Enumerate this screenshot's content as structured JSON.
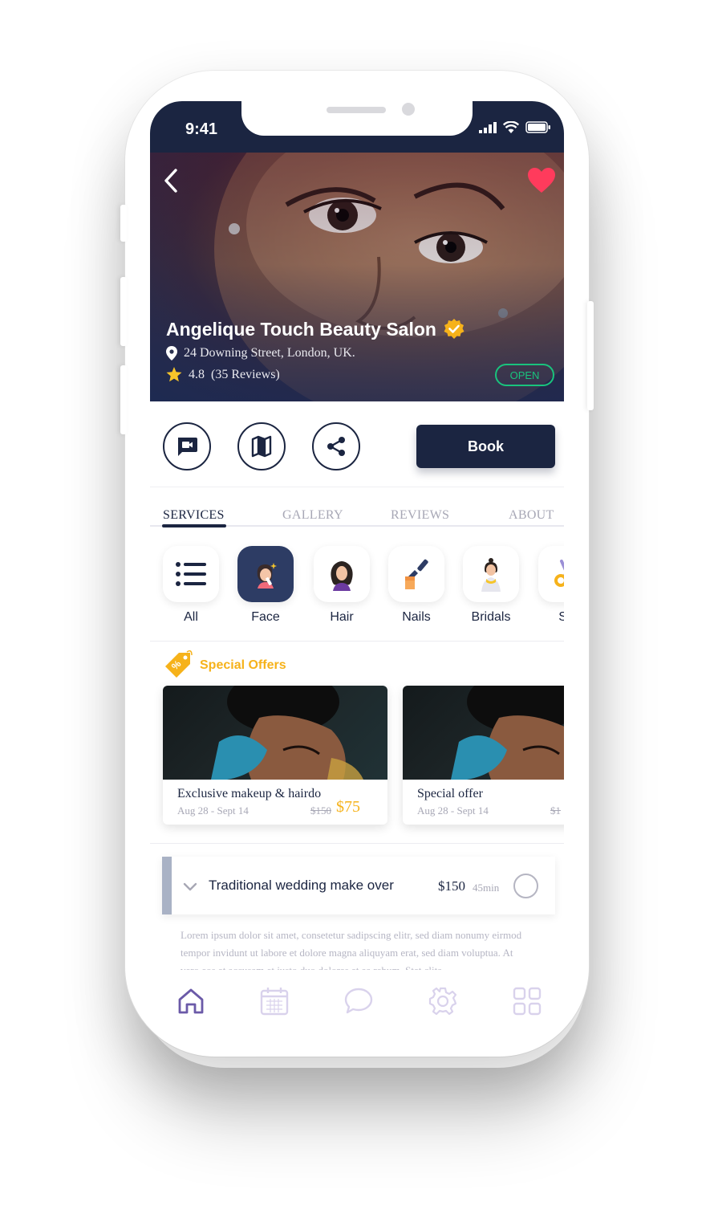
{
  "status_bar": {
    "time": "9:41"
  },
  "salon": {
    "name": "Angelique Touch Beauty Salon",
    "address": "24 Downing Street, London, UK.",
    "rating": "4.8",
    "reviews": "(35 Reviews)",
    "status": "OPEN"
  },
  "actions": {
    "book_label": "Book"
  },
  "tabs": [
    {
      "label": "SERVICES",
      "active": true
    },
    {
      "label": "GALLERY",
      "active": false
    },
    {
      "label": "REVIEWS",
      "active": false
    },
    {
      "label": "ABOUT",
      "active": false
    }
  ],
  "categories": [
    {
      "label": "All",
      "icon": "list-icon",
      "active": false
    },
    {
      "label": "Face",
      "icon": "face-makeup-icon",
      "active": true
    },
    {
      "label": "Hair",
      "icon": "hair-icon",
      "active": false
    },
    {
      "label": "Nails",
      "icon": "nail-polish-icon",
      "active": false
    },
    {
      "label": "Bridals",
      "icon": "bride-icon",
      "active": false
    },
    {
      "label": "Sa",
      "icon": "scissors-icon",
      "active": false
    }
  ],
  "special_offers": {
    "title": "Special Offers",
    "items": [
      {
        "title": "Exclusive makeup & hairdo",
        "dates": "Aug 28 - Sept 14",
        "old_price": "$150",
        "new_price": "$75"
      },
      {
        "title": "Special offer",
        "dates": "Aug 28 - Sept 14",
        "old_price": "$1",
        "new_price": ""
      }
    ]
  },
  "service": {
    "name": "Traditional wedding make over",
    "price": "$150",
    "duration": "45min",
    "description": "Lorem ipsum dolor sit amet, consetetur sadipscing elitr, sed diam nonumy eirmod tempor invidunt ut labore et dolore magna aliquyam erat, sed diam voluptua. At vero eos et accusam et justo duo dolores et ea rebum. Stet clita"
  },
  "bottom_nav": [
    {
      "icon": "home-icon",
      "active": true
    },
    {
      "icon": "calendar-icon",
      "active": false
    },
    {
      "icon": "chat-icon",
      "active": false
    },
    {
      "icon": "settings-icon",
      "active": false
    },
    {
      "icon": "grid-icon",
      "active": false
    }
  ],
  "colors": {
    "primary": "#1b2541",
    "accent": "#f6b21a",
    "open": "#19c37d",
    "heart": "#ff3b5c",
    "nav_active": "#6b5aa8",
    "nav_inactive": "#d9d2ec"
  }
}
